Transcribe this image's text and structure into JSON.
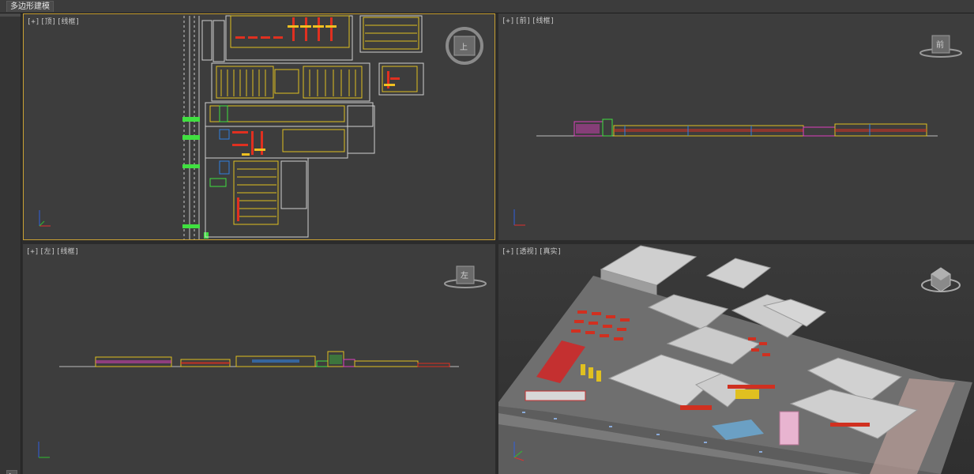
{
  "ribbon": {
    "tab_label": "多边形建模"
  },
  "viewports": {
    "top": {
      "plus": "[+]",
      "view": "[顶]",
      "shading": "[线框]",
      "cube_face": "上"
    },
    "front": {
      "plus": "[+]",
      "view": "[前]",
      "shading": "[线框]",
      "cube_face": "前"
    },
    "left": {
      "plus": "[+]",
      "view": "[左]",
      "shading": "[线框]",
      "cube_face": "左"
    },
    "perspective": {
      "plus": "[+]",
      "view": "[透视]",
      "shading": "[真实]"
    }
  },
  "icons": {
    "viewcube": "viewcube-icon",
    "axis": "axis-tripod-icon",
    "play": "play-icon"
  },
  "colors": {
    "active_border": "#c8a033",
    "viewport_bg": "#3d3d3d",
    "wire_yellow": "#e0c020",
    "wire_red": "#e03020",
    "wire_green": "#40e040",
    "wire_magenta": "#e040c0",
    "wire_blue": "#3080e0"
  }
}
